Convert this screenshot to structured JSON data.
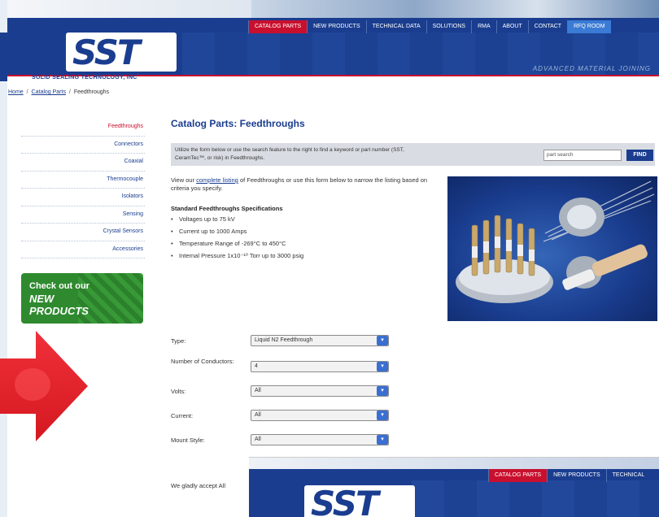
{
  "header": {
    "company_name": "SOLID SEALING TECHNOLOGY, INC",
    "logo_text": "SST",
    "tagline": "ADVANCED MATERIAL JOINING",
    "nav": [
      {
        "label": "CATALOG PARTS"
      },
      {
        "label": "NEW PRODUCTS"
      },
      {
        "label": "TECHNICAL DATA"
      },
      {
        "label": "SOLUTIONS"
      },
      {
        "label": "RMA"
      },
      {
        "label": "ABOUT"
      },
      {
        "label": "CONTACT"
      },
      {
        "label": "RFQ ROOM"
      }
    ]
  },
  "breadcrumb": {
    "home": "Home",
    "catalog": "Catalog Parts",
    "current": "Feedthroughs",
    "separator": "/"
  },
  "sidebar": {
    "items": [
      {
        "label": "Feedthroughs",
        "active": true
      },
      {
        "label": "Connectors"
      },
      {
        "label": "Coaxial"
      },
      {
        "label": "Thermocouple"
      },
      {
        "label": "Isolators"
      },
      {
        "label": "Sensing"
      },
      {
        "label": "Crystal Sensors"
      },
      {
        "label": "Accessories"
      }
    ],
    "promo": {
      "line1": "Check out our",
      "line2": "NEW",
      "line3": "PRODUCTS"
    }
  },
  "main": {
    "title": "Catalog Parts: Feedthroughs",
    "search": {
      "hint": "Utilize the form below or use the search feature to the right to find a keyword or part number (SST, CeramTec™, or risk) in Feedthroughs.",
      "placeholder": "part search",
      "button": "FIND"
    },
    "intro_prefix": "View our",
    "intro_link": "complete listing",
    "intro_suffix": "of Feedthroughs or use this form below to narrow the listing based on criteria you specify.",
    "specs_title": "Standard Feedthroughs Specifications",
    "specs": [
      "Voltages up to 75 kV",
      "Current up to 1000 Amps",
      "Temperature Range of -269°C to 450°C",
      "Internal Pressure 1x10⁻¹⁰ Torr up to 3000 psig"
    ],
    "form": {
      "type_label": "Type:",
      "type_value": "Liquid N2 Feedthrough",
      "conductors_label": "Number of Conductors:",
      "conductors_value": "4",
      "volts_label": "Volts:",
      "volts_value": "All",
      "current_label": "Current:",
      "current_value": "All",
      "mount_label": "Mount Style:",
      "mount_value": "All"
    },
    "bottom_text": "We gladly accept All"
  },
  "overlay": {
    "logo_text": "SST",
    "nav": [
      {
        "label": "CATALOG PARTS"
      },
      {
        "label": "NEW PRODUCTS"
      },
      {
        "label": "TECHNICAL"
      }
    ]
  },
  "colors": {
    "brand_blue": "#1a3d8f",
    "accent_red": "#c8102e",
    "promo_green": "#2f8a2f",
    "arrow_red": "#e8202a"
  }
}
